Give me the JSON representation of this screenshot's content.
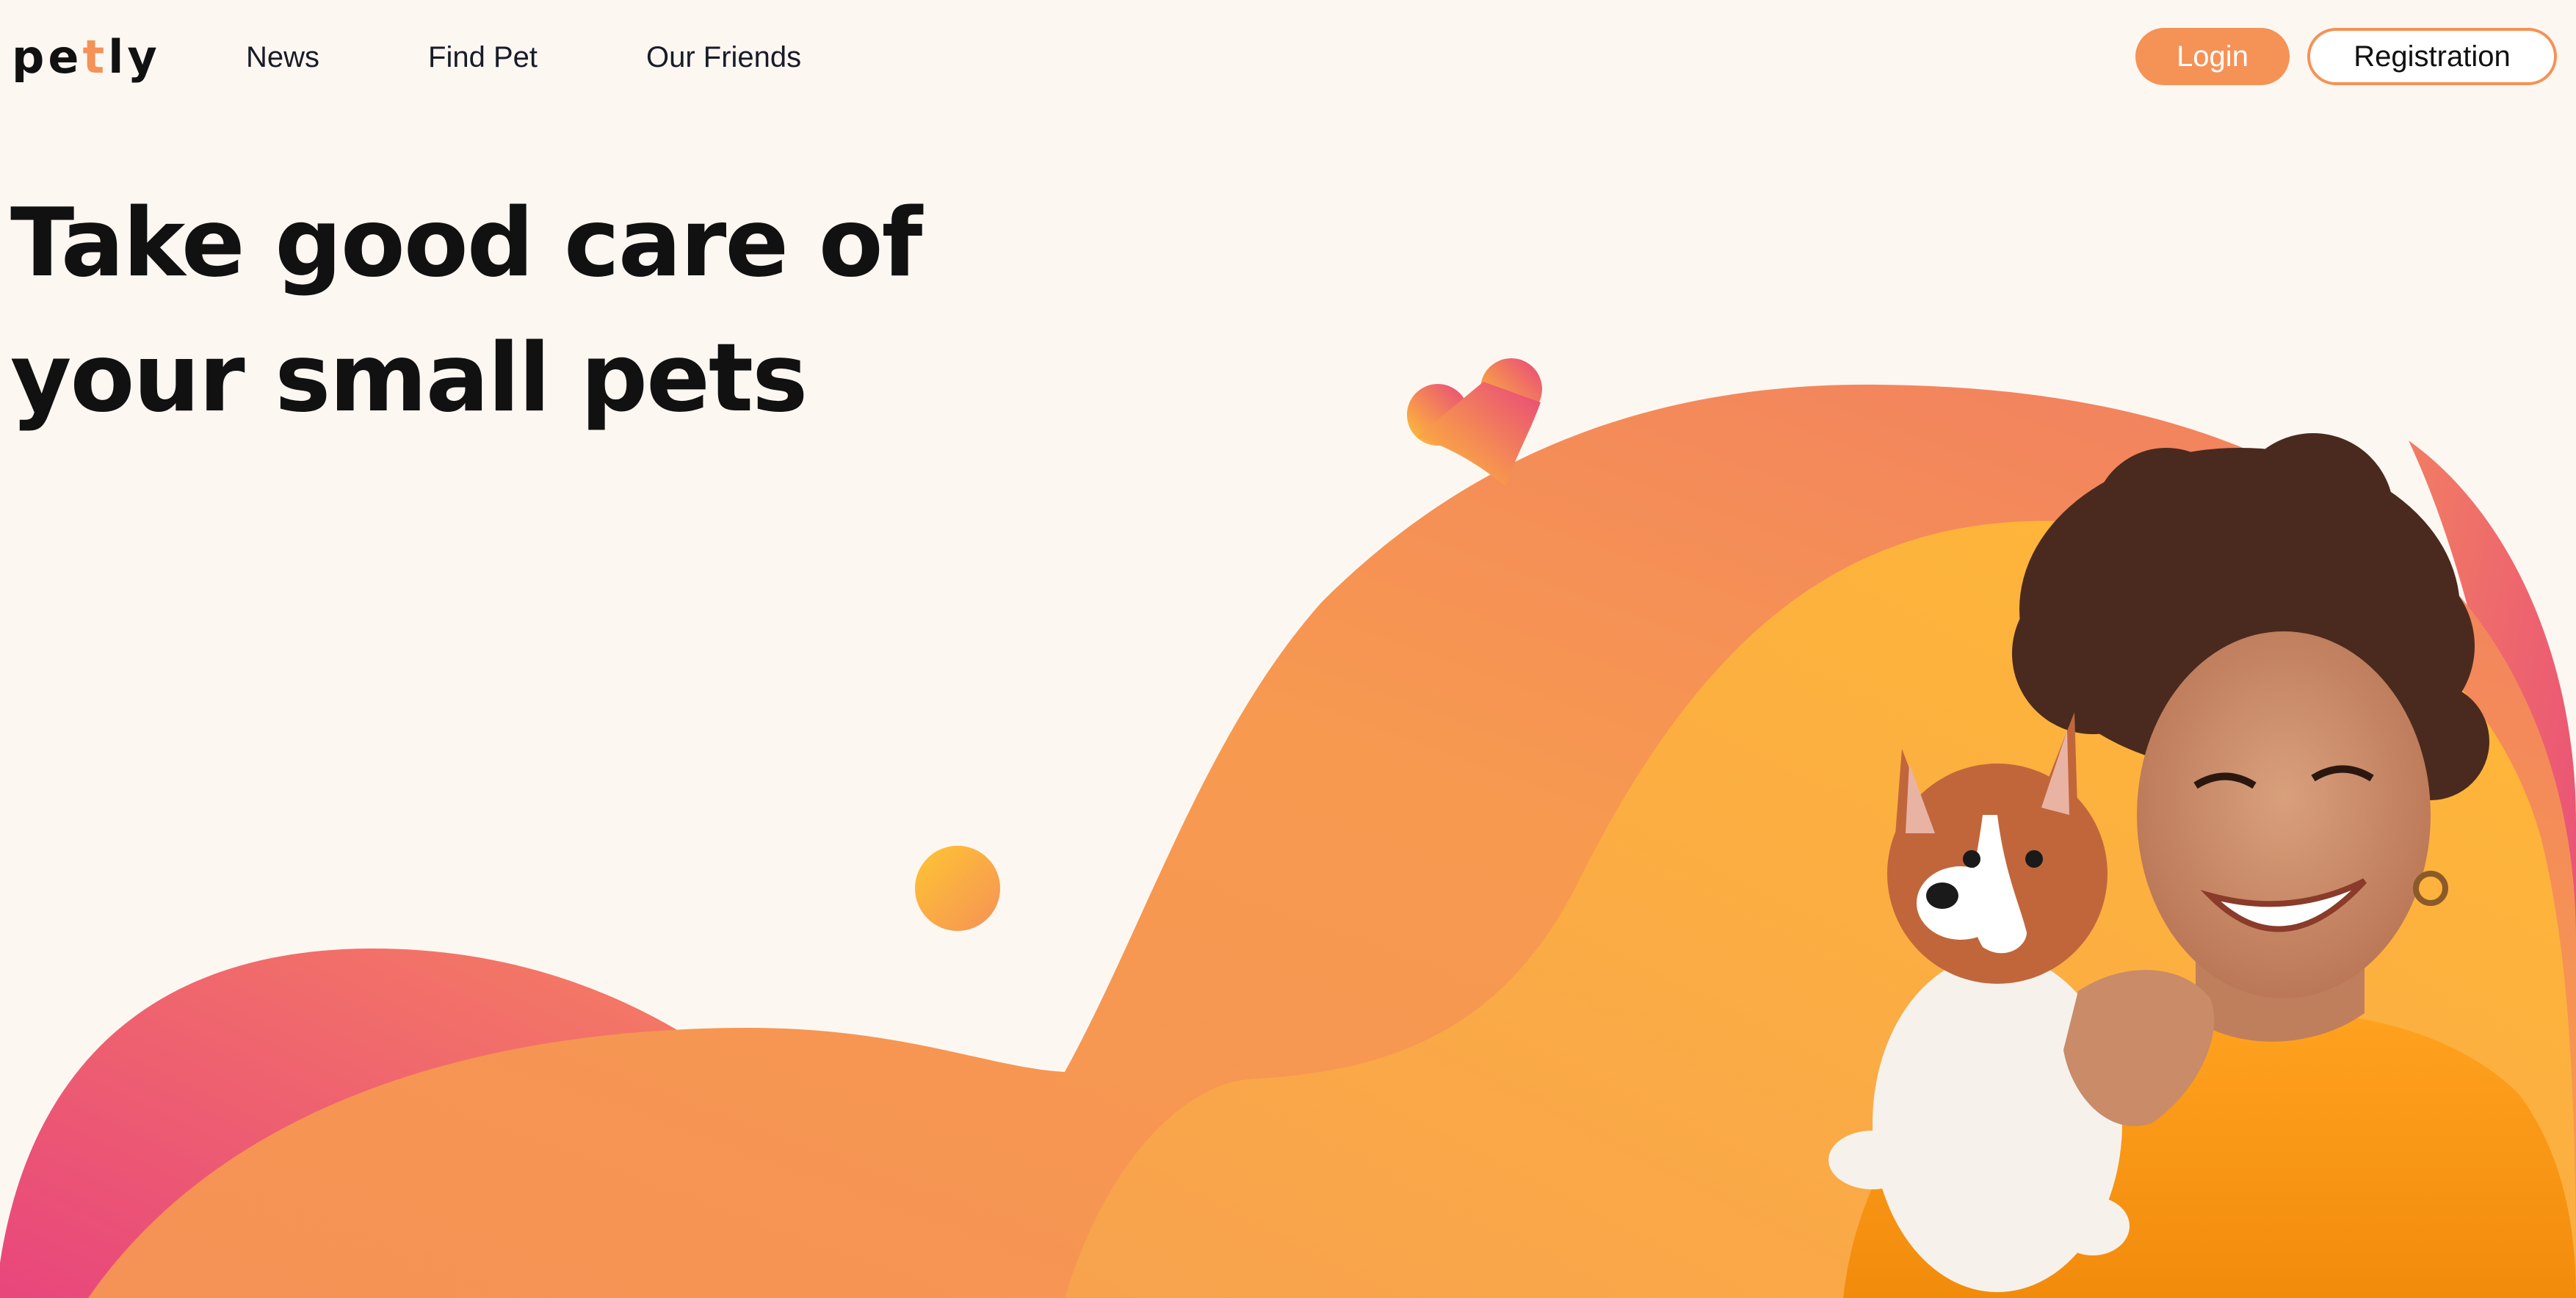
{
  "header": {
    "logo": {
      "letters": [
        "p",
        "e",
        "t",
        "l",
        "y"
      ],
      "accent_letter_index": 2
    },
    "nav": [
      {
        "label": "News"
      },
      {
        "label": "Find Pet"
      },
      {
        "label": "Our Friends"
      }
    ],
    "auth": {
      "login_label": "Login",
      "register_label": "Registration"
    }
  },
  "hero": {
    "title_lines": [
      "Take good care of",
      "your small pets"
    ],
    "image_subject": "smiling woman holding a puppy"
  },
  "colors": {
    "background": "#FDF7F2",
    "accent": "#F59256",
    "gradient_orange": "#F59256",
    "gradient_yellow": "#FFC533",
    "gradient_pink": "#E8467C",
    "text": "#111111"
  }
}
